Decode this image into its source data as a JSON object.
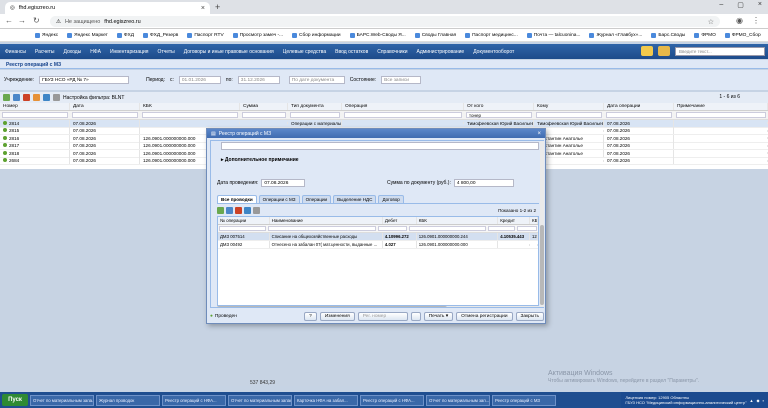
{
  "browser": {
    "tab_title": "fhd.egiszreo.ru",
    "url_status": "Не защищено",
    "url": "fhd.egiszreo.ru",
    "bookmarks": [
      "Яндекс",
      "Яндекс Маркет",
      "ФХД",
      "ФХД_Резерв",
      "Паспорт RTV",
      "Просмотр замеч -...",
      "Сбор информации",
      "БАРС.Web-Своды Я...",
      "Своды Главная",
      "Паспорт медицинс...",
      "Почта — talcuonina...",
      "Журнал «Главбух»...",
      "Барс.Своды",
      "ФРМО",
      "ФРМО_Сбор"
    ]
  },
  "app_menu": {
    "items": [
      "Финансы",
      "Расчеты",
      "Доходы",
      "НФА",
      "Инвентаризация",
      "Отчеты",
      "Договоры и иные правовые основания",
      "Целевые средства",
      "Ввод остатков",
      "Справочники",
      "Администрирование",
      "Документооборот"
    ],
    "search_placeholder": "Введите текст..."
  },
  "list": {
    "title": "Реестр операций с МЗ",
    "filters": {
      "org_label": "Учреждение:",
      "org_value": "ГБУЗ НСО «РД № 7»",
      "period_label": "Период:",
      "from_label": "с:",
      "from_value": "01.01.2026",
      "to_label": "по:",
      "to_value": "31.12.2026",
      "date_type": "По дате документа",
      "state_label": "Состояние:",
      "state_value": "Все записи"
    },
    "filter_settings": "Настройка фильтра: BLNT",
    "pager": "1 - 6 из 6",
    "columns": [
      "Номер",
      "Дата",
      "КБК",
      "Сумма",
      "Тип документа",
      "Операция",
      "От кого",
      "Кому",
      "Дата операции",
      "Примечание"
    ],
    "filter_value": "тонер",
    "rows": [
      {
        "num": "2814",
        "date": "07.08.2026",
        "kbk": "",
        "sum": "",
        "type": "Операции с материальны ы",
        "op": "",
        "from": "Тимофеевская Юрий Васильевич",
        "to": "Тимофеевская Юрий Васильевич",
        "opdate": "07.08.2026"
      },
      {
        "num": "2815",
        "date": "07.08.2026",
        "kbk": "",
        "sum": "",
        "type": "",
        "op": "",
        "from": "",
        "to": "",
        "opdate": "07.08.2026"
      },
      {
        "num": "2816",
        "date": "07.08.2026",
        "kbk": "126.0901.000000000.000",
        "sum": "",
        "type": "",
        "op": "",
        "from": "",
        "to": "Константин Анатолье",
        "opdate": "07.08.2026"
      },
      {
        "num": "2817",
        "date": "07.08.2026",
        "kbk": "126.0901.000000000.000",
        "sum": "",
        "type": "",
        "op": "",
        "from": "",
        "to": "Константин Анатолье",
        "opdate": "07.08.2026"
      },
      {
        "num": "2818",
        "date": "07.08.2026",
        "kbk": "126.0901.000000000.000",
        "sum": "",
        "type": "",
        "op": "",
        "from": "",
        "to": "Константин Анатолье",
        "opdate": "07.08.2026"
      },
      {
        "num": "2684",
        "date": "07.08.2026",
        "kbk": "126.0901.000000000.000",
        "sum": "",
        "type": "",
        "op": "",
        "from": "",
        "to": "",
        "opdate": "07.08.2026"
      }
    ],
    "total": "537 843,29"
  },
  "dialog": {
    "title": "Реестр операций с МЗ",
    "additional_note": "Дополнительное примечание",
    "date_label": "Дата проведения:",
    "date_value": "07.08.2026",
    "sum_label": "Сумма по документу (руб.):",
    "sum_value": "4 800,00",
    "tabs": [
      "Все проводки",
      "Операции с МЗ",
      "Операции",
      "Выделение НДС",
      "Договор"
    ],
    "shown": "Показано 1-2 из 2",
    "columns": [
      "№ операции",
      "Наименование",
      "Дебет",
      "КБК",
      "Кредит",
      "КБК"
    ],
    "rows": [
      {
        "num": "ДМЗ 007514",
        "name": "Списание на общехозяйственные расходы",
        "debit": "4.10996.272",
        "kbk1": "126.0901.000000000.244",
        "credit": "4.10535.443",
        "kbk2": "126.0901"
      },
      {
        "num": "ДМЗ 00492",
        "name": "Отнесено на забалан 07( мат.ценности, выданные ...",
        "debit": "4.027",
        "kbk1": "126.0901.000000000.000",
        "credit": "",
        "kbk2": ""
      }
    ],
    "footer": {
      "status": "Проведен",
      "edit": "Изменения",
      "reg_label": "Рег. номер",
      "print": "Печать",
      "cancel_reg": "Отмена регистрации",
      "close": "Закрыть"
    }
  },
  "watermark": {
    "line1": "Активация Windows",
    "line2": "Чтобы активировать Windows, перейдите в раздел \"Параметры\"."
  },
  "taskbar": {
    "start": "Пуск",
    "items": [
      "Отчет по материальным запа...",
      "Журнал проводок",
      "Реестр операций с НФА...",
      "Отчет по материальным запасам",
      "Карточка НФА на забал...",
      "Реестр операций с НФА...",
      "Отчет по материальным зап...",
      "Реестр операций с МЗ"
    ],
    "tray_line1": "Лицензия номер: 12905 Областны",
    "tray_line2": "ГБУЗ НСО \"Медицинский информационно-аналитический центр\""
  }
}
